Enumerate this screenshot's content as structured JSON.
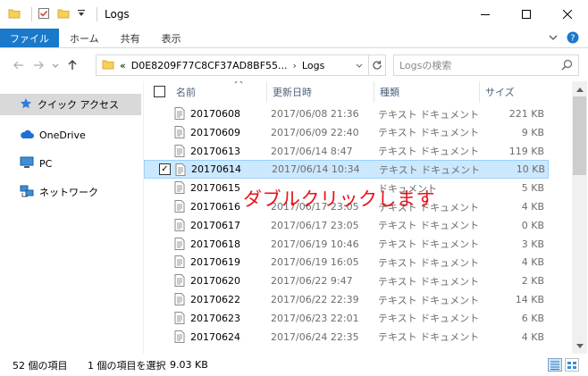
{
  "window": {
    "title": "Logs"
  },
  "ribbon": {
    "tabs": [
      "ファイル",
      "ホーム",
      "共有",
      "表示"
    ]
  },
  "address": {
    "prefix": "«",
    "crumbs": [
      "D0E8209F77C8CF37AD8BF55...",
      "Logs"
    ]
  },
  "search": {
    "placeholder": "Logsの検索"
  },
  "nav": {
    "items": [
      "クイック アクセス",
      "OneDrive",
      "PC",
      "ネットワーク"
    ]
  },
  "columns": {
    "name": "名前",
    "date": "更新日時",
    "type": "種類",
    "size": "サイズ"
  },
  "files": [
    {
      "name": "20170608",
      "date": "2017/06/08 21:36",
      "type": "テキスト ドキュメント",
      "size": "221 KB"
    },
    {
      "name": "20170609",
      "date": "2017/06/09 22:40",
      "type": "テキスト ドキュメント",
      "size": "9 KB"
    },
    {
      "name": "20170613",
      "date": "2017/06/14 8:47",
      "type": "テキスト ドキュメント",
      "size": "119 KB"
    },
    {
      "name": "20170614",
      "date": "2017/06/14 10:34",
      "type": "テキスト ドキュメント",
      "size": "10 KB",
      "selected": true
    },
    {
      "name": "20170615",
      "date": "",
      "type": "ドキュメント",
      "size": "5 KB"
    },
    {
      "name": "20170616",
      "date": "2017/06/17 23:05",
      "type": "テキスト ドキュメント",
      "size": "4 KB"
    },
    {
      "name": "20170617",
      "date": "2017/06/17 23:05",
      "type": "テキスト ドキュメント",
      "size": "0 KB"
    },
    {
      "name": "20170618",
      "date": "2017/06/19 10:46",
      "type": "テキスト ドキュメント",
      "size": "3 KB"
    },
    {
      "name": "20170619",
      "date": "2017/06/19 16:05",
      "type": "テキスト ドキュメント",
      "size": "4 KB"
    },
    {
      "name": "20170620",
      "date": "2017/06/22 9:47",
      "type": "テキスト ドキュメント",
      "size": "2 KB"
    },
    {
      "name": "20170622",
      "date": "2017/06/22 22:39",
      "type": "テキスト ドキュメント",
      "size": "14 KB"
    },
    {
      "name": "20170623",
      "date": "2017/06/23 22:01",
      "type": "テキスト ドキュメント",
      "size": "6 KB"
    },
    {
      "name": "20170624",
      "date": "2017/06/24 22:35",
      "type": "テキスト ドキュメント",
      "size": "4 KB"
    }
  ],
  "annotation": "ダブルクリックします",
  "status": {
    "count": "52 個の項目",
    "selection": "1 個の項目を選択",
    "selsize": "9.03 KB"
  },
  "colors": {
    "file_tab": "#1979ca",
    "selection": "#cce8ff",
    "annotation": "#e8131a"
  }
}
